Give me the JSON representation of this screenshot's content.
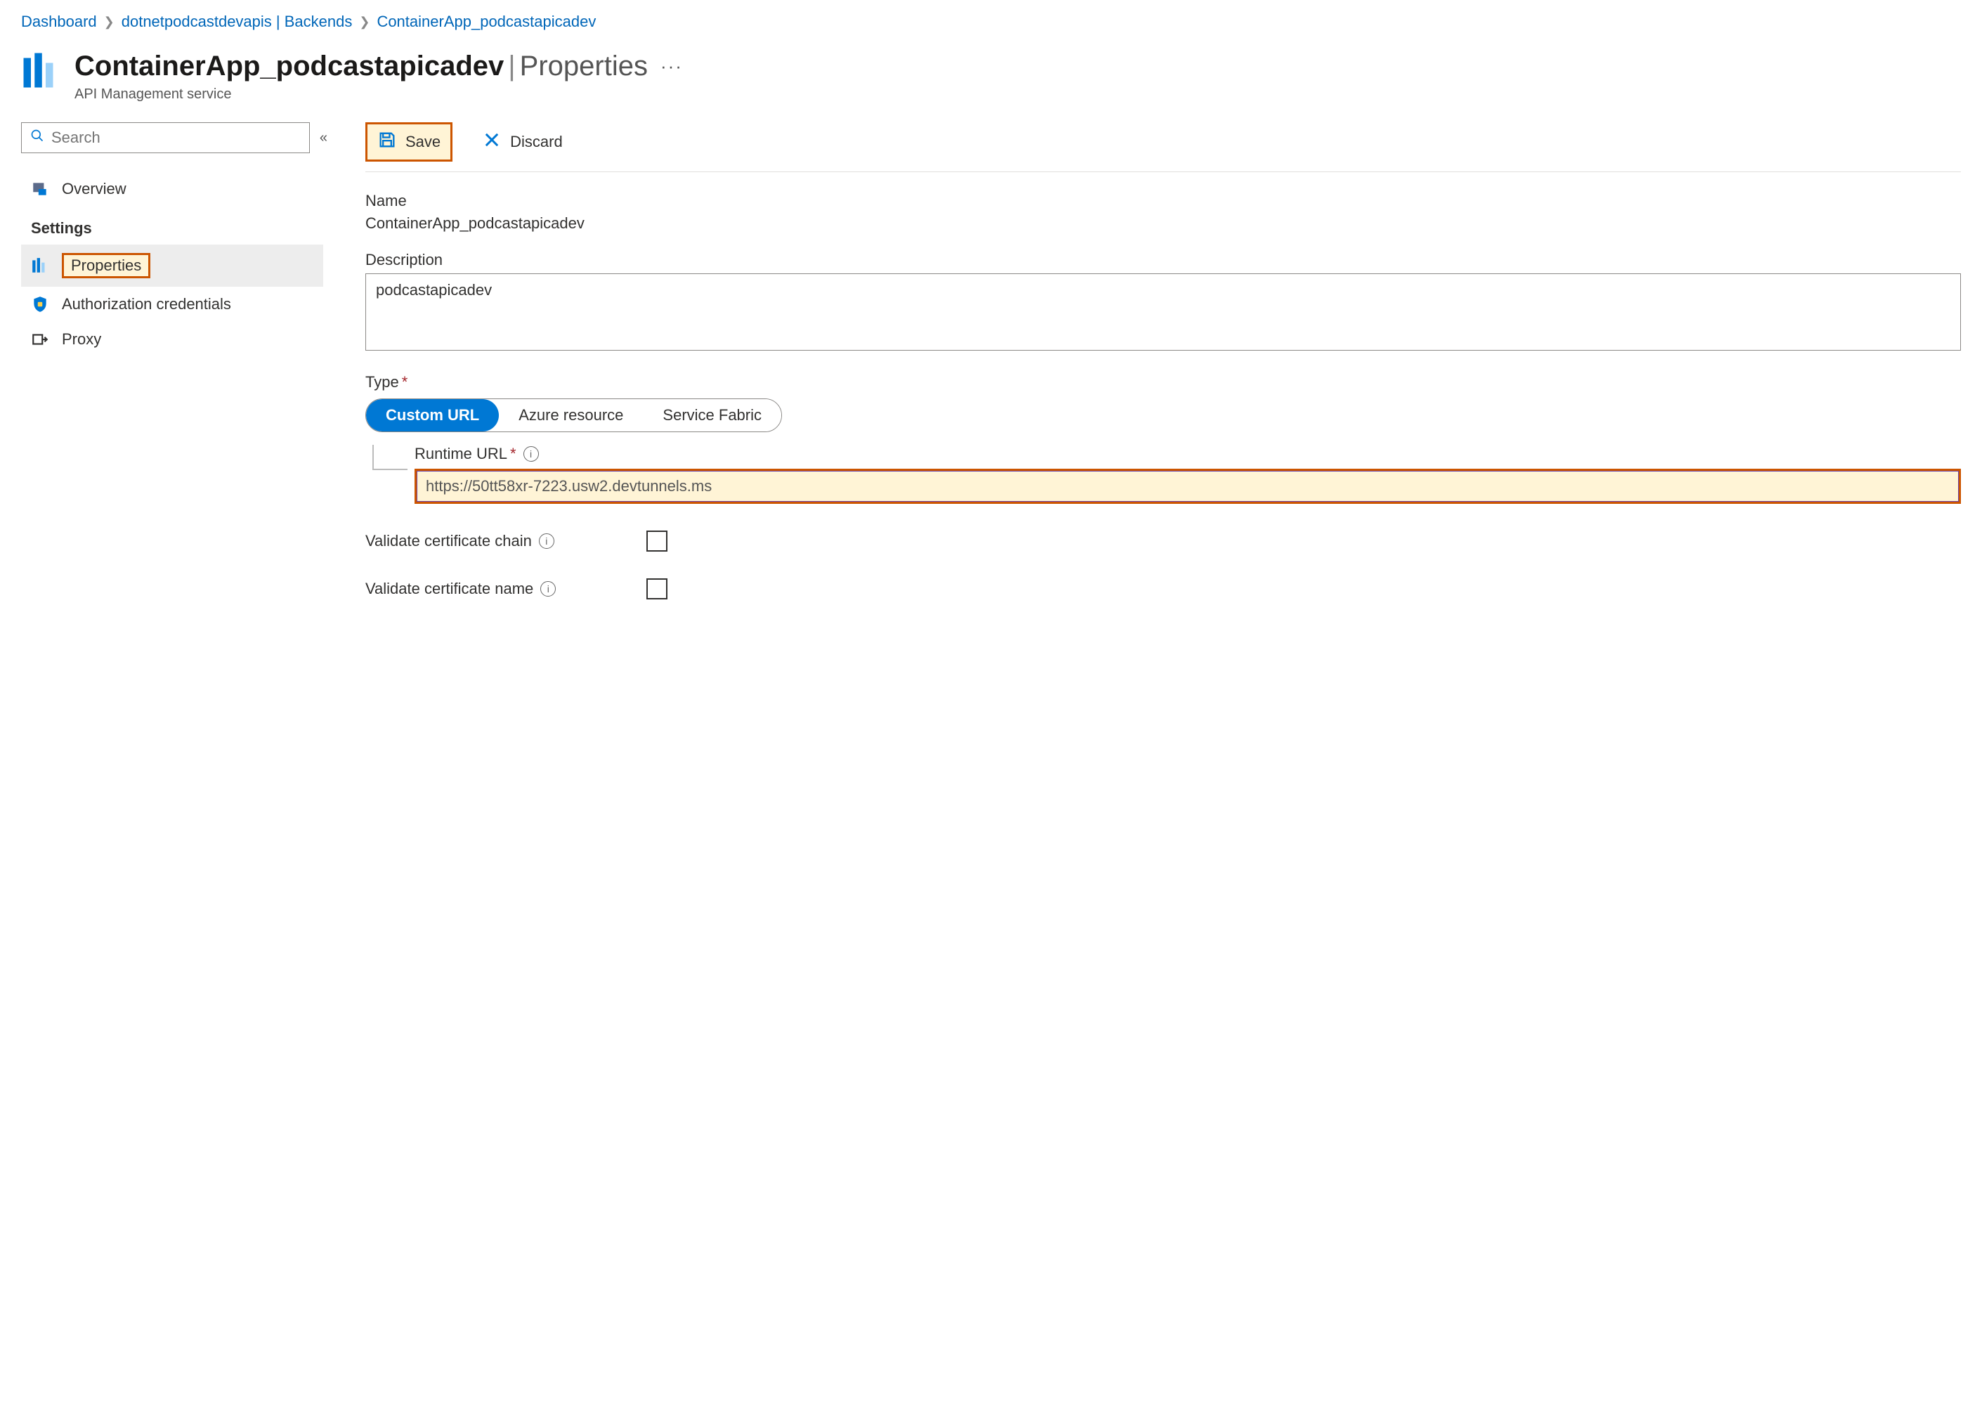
{
  "breadcrumb": {
    "items": [
      {
        "label": "Dashboard"
      },
      {
        "label": "dotnetpodcastdevapis | Backends"
      },
      {
        "label": "ContainerApp_podcastapicadev"
      }
    ]
  },
  "header": {
    "resource_name": "ContainerApp_podcastapicadev",
    "subpage": "Properties",
    "subtitle": "API Management service"
  },
  "sidebar": {
    "search_placeholder": "Search",
    "overview": "Overview",
    "settings_label": "Settings",
    "items": [
      {
        "label": "Properties"
      },
      {
        "label": "Authorization credentials"
      },
      {
        "label": "Proxy"
      }
    ]
  },
  "toolbar": {
    "save_label": "Save",
    "discard_label": "Discard"
  },
  "form": {
    "name_label": "Name",
    "name_value": "ContainerApp_podcastapicadev",
    "description_label": "Description",
    "description_value": "podcastapicadev",
    "type_label": "Type",
    "type_options": {
      "custom": "Custom URL",
      "azure": "Azure resource",
      "fabric": "Service Fabric"
    },
    "runtime_label": "Runtime URL",
    "runtime_value": "https://50tt58xr-7223.usw2.devtunnels.ms",
    "validate_chain_label": "Validate certificate chain",
    "validate_name_label": "Validate certificate name"
  }
}
